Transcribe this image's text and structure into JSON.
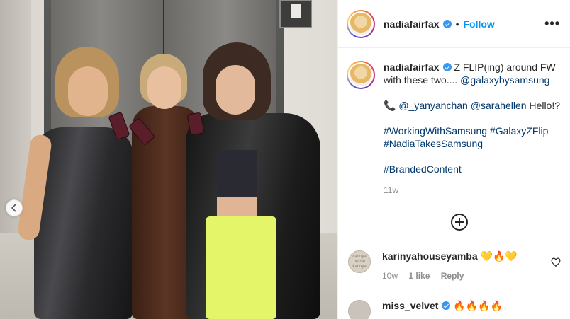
{
  "post": {
    "author": "nadiafairfax",
    "follow_label": "Follow",
    "dot_sep": "•",
    "more_label": "•••",
    "caption_lines": {
      "line1": " Z FLIP(ing) around FW with these two.... ",
      "mention_main": "@galaxybysamsung",
      "line2_icon": "📞 ",
      "mention_1": "@_yanyanchan",
      "mention_2": "@sarahellen",
      "line2_tail": " Hello!?",
      "hashtag_1": "#WorkingWithSamsung",
      "hashtag_2": "#GalaxyZFlip",
      "hashtag_3": "#NadiaTakesSamsung",
      "hashtag_4": "#BrandedContent"
    },
    "timestamp": "11w"
  },
  "comments": [
    {
      "user": "karinyahouseyamba",
      "text": " 💛🔥💛",
      "avatar_text": "carinya house karinya",
      "age": "10w",
      "likes": "1 like",
      "reply_label": "Reply"
    },
    {
      "user": "miss_velvet",
      "text": " 🔥🔥🔥🔥",
      "avatar_text": ""
    }
  ],
  "icons": {
    "carousel_prev": "chevron-left-icon",
    "load_more": "plus-circle-icon",
    "like": "heart-icon",
    "verified": "verified-badge-icon"
  },
  "colors": {
    "follow": "#0095f6",
    "link": "#00376b",
    "meta": "#8e8e8e",
    "verified": "#3897f0"
  }
}
